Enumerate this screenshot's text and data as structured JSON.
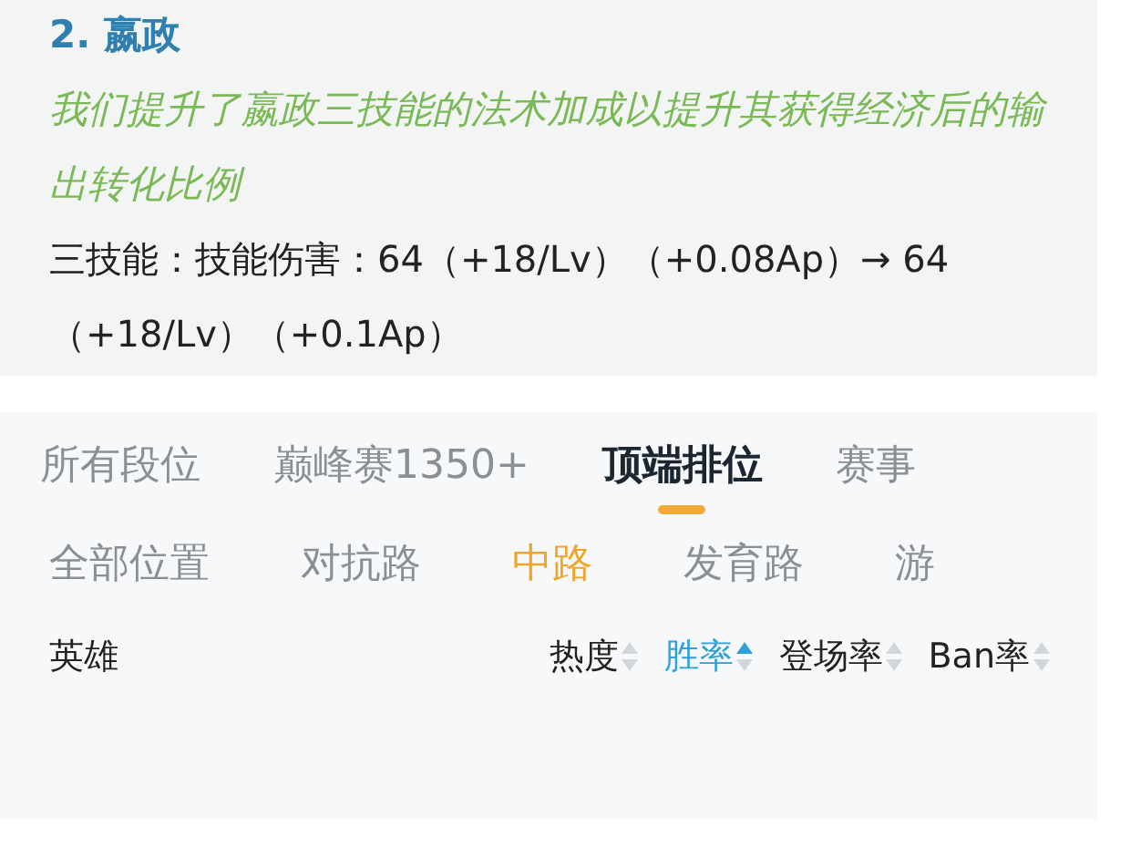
{
  "change_note": {
    "title": "2.  嬴政",
    "description": "我们提升了嬴政三技能的法术加成以提升其获得经济后的输出转化比例",
    "detail": "三技能：技能伤害：64（+18/Lv）（+0.08Ap）→ 64（+18/Lv）（+0.1Ap）"
  },
  "rank_tabs": [
    {
      "label": "所有段位",
      "selected": false
    },
    {
      "label": "巅峰赛1350+",
      "selected": false
    },
    {
      "label": "顶端排位",
      "selected": true
    },
    {
      "label": "赛事",
      "selected": false
    }
  ],
  "position_tabs": [
    {
      "label": "全部位置",
      "selected": false
    },
    {
      "label": "对抗路",
      "selected": false
    },
    {
      "label": "中路",
      "selected": true
    },
    {
      "label": "发育路",
      "selected": false
    },
    {
      "label": "游",
      "selected": false
    }
  ],
  "table": {
    "columns": [
      {
        "label": "英雄",
        "sortable": false,
        "selected": false
      },
      {
        "label": "热度",
        "sortable": true,
        "selected": false
      },
      {
        "label": "胜率",
        "sortable": true,
        "selected": true
      },
      {
        "label": "登场率",
        "sortable": true,
        "selected": false
      },
      {
        "label": "Ban率",
        "sortable": true,
        "selected": false
      }
    ]
  }
}
